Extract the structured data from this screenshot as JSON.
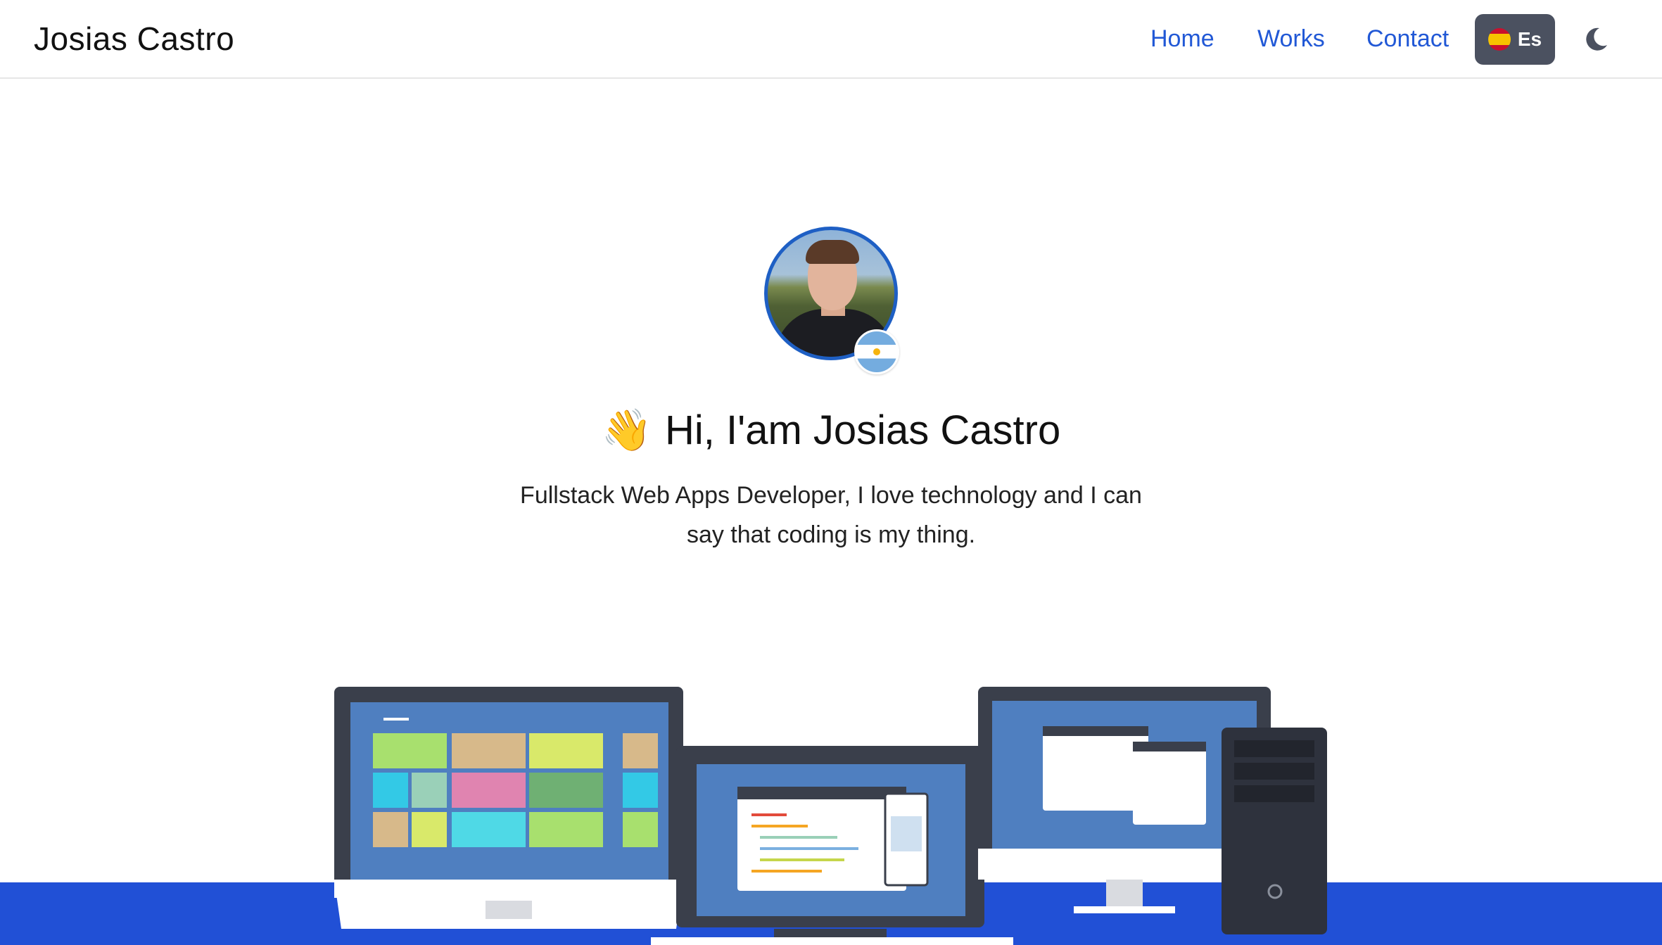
{
  "header": {
    "brand": "Josias Castro",
    "nav": {
      "home": "Home",
      "works": "Works",
      "contact": "Contact"
    },
    "language_button": "Es",
    "theme_icon": "moon-icon"
  },
  "hero": {
    "wave_emoji": "👋",
    "greeting": "Hi, I'am Josias Castro",
    "subtitle": "Fullstack Web Apps Developer, I love technology and I can say that coding is my thing."
  },
  "colors": {
    "accent": "#2158d6",
    "band": "#2150d6",
    "lang_button_bg": "#4b5160",
    "avatar_border": "#1e5fc4"
  }
}
